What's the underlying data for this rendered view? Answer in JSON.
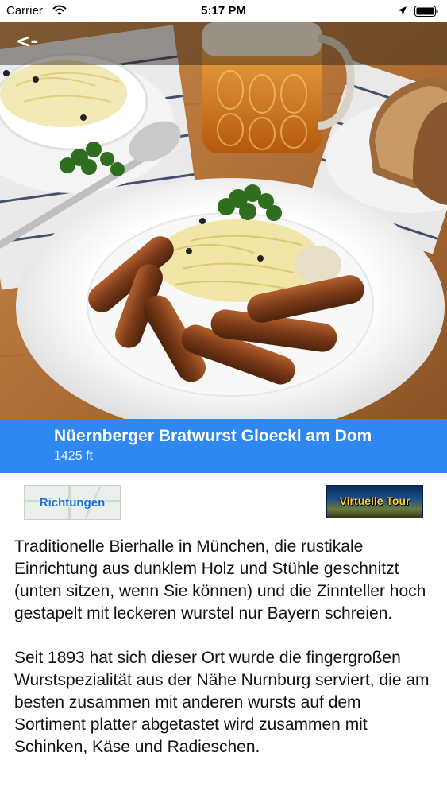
{
  "status_bar": {
    "carrier": "Carrier",
    "time": "5:17 PM",
    "icons": [
      "wifi-icon",
      "location-arrow-icon",
      "battery-icon"
    ]
  },
  "nav": {
    "back_label": "<-"
  },
  "place": {
    "name": "Nüernberger Bratwurst Gloeckl am Dom",
    "distance": "1425 ft",
    "hero_image": "plate-of-bratwurst-with-sauerkraut-and-beer"
  },
  "actions": {
    "directions_label": "Richtungen",
    "tour_label": "Virtuelle Tour"
  },
  "description": {
    "paragraphs": [
      "Traditionelle Bierhalle in München, die rustikale Einrichtung aus dunklem Holz und Stühle geschnitzt (unten sitzen, wenn Sie können) und die Zinnteller hoch gestapelt mit leckeren wurstel nur Bayern schreien.",
      "Seit 1893 hat sich dieser Ort wurde die fingergroßen Wurstspezialität aus der Nähe Nurnburg serviert, die am besten zusammen mit anderen wursts auf dem Sortiment platter abgetastet wird zusammen mit Schinken, Käse und Radieschen."
    ]
  },
  "colors": {
    "title_band": "#2f88f2",
    "title_text": "#ffffff",
    "body_text": "#111111",
    "directions_text": "#1c6fd6",
    "tour_text": "#f5d43a"
  }
}
